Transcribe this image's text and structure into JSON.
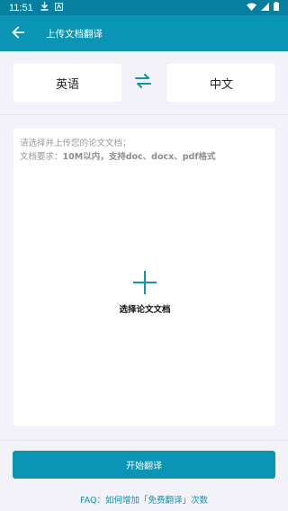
{
  "status_bar": {
    "time": "11:51",
    "icons": [
      "download-icon",
      "app-icon",
      "wifi-icon",
      "signal-icon",
      "battery-icon"
    ]
  },
  "app_bar": {
    "title": "上传文档翻译",
    "back_icon": "arrow-left-icon"
  },
  "languages": {
    "source": "英语",
    "target": "中文",
    "swap_icon": "swap-icon"
  },
  "upload": {
    "hint_line1": "请选择并上传您的论文文档；",
    "hint_line2_prefix": "文档要求：",
    "hint_line2_strong": "10M以内，支持doc、docx、pdf格式",
    "button_label": "选择论文文档",
    "button_icon": "plus-icon"
  },
  "actions": {
    "start_label": "开始翻译",
    "faq_text": "FAQ：如何增加「免费翻译」次数"
  },
  "colors": {
    "primary": "#0b95b5",
    "status_bar": "#06809e",
    "background": "#f3f2f8"
  }
}
